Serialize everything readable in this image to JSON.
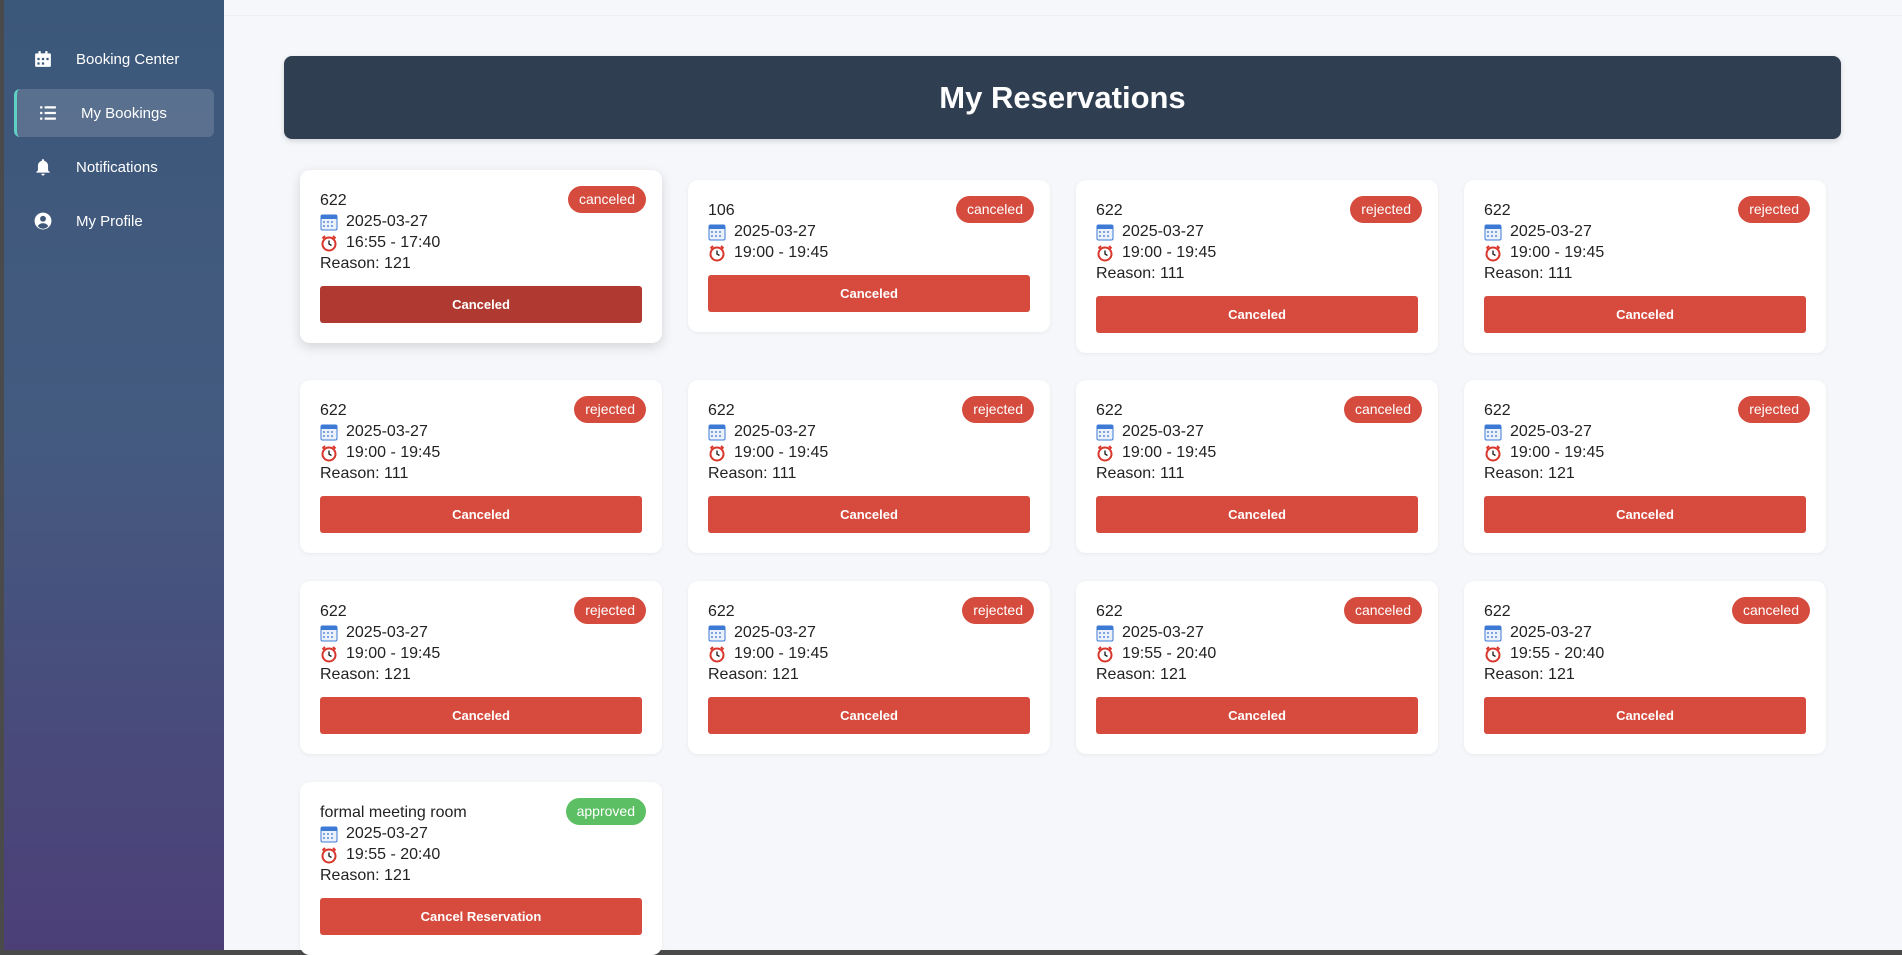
{
  "sidebar": {
    "items": [
      {
        "label": "Booking Center",
        "icon": "calendar-icon",
        "active": false
      },
      {
        "label": "My Bookings",
        "icon": "list-icon",
        "active": true
      },
      {
        "label": "Notifications",
        "icon": "bell-icon",
        "active": false
      },
      {
        "label": "My Profile",
        "icon": "user-circle-icon",
        "active": false
      }
    ]
  },
  "header": {
    "title": "My Reservations"
  },
  "colors": {
    "header_bg": "#2f3e51",
    "danger": "#d74b3e",
    "approved": "#5cbf63",
    "sidebar_top": "#3b5779",
    "sidebar_bottom": "#4c3f78"
  },
  "reservations": [
    {
      "room": "622",
      "date": "2025-03-27",
      "time": "16:55 - 17:40",
      "reason": "Reason: 121",
      "status": "canceled",
      "button": "Canceled"
    },
    {
      "room": "106",
      "date": "2025-03-27",
      "time": "19:00 - 19:45",
      "reason": "",
      "status": "canceled",
      "button": "Canceled"
    },
    {
      "room": "622",
      "date": "2025-03-27",
      "time": "19:00 - 19:45",
      "reason": "Reason: 111",
      "status": "rejected",
      "button": "Canceled"
    },
    {
      "room": "622",
      "date": "2025-03-27",
      "time": "19:00 - 19:45",
      "reason": "Reason: 111",
      "status": "rejected",
      "button": "Canceled"
    },
    {
      "room": "622",
      "date": "2025-03-27",
      "time": "19:00 - 19:45",
      "reason": "Reason: 111",
      "status": "rejected",
      "button": "Canceled"
    },
    {
      "room": "622",
      "date": "2025-03-27",
      "time": "19:00 - 19:45",
      "reason": "Reason: 111",
      "status": "rejected",
      "button": "Canceled"
    },
    {
      "room": "622",
      "date": "2025-03-27",
      "time": "19:00 - 19:45",
      "reason": "Reason: 111",
      "status": "canceled",
      "button": "Canceled"
    },
    {
      "room": "622",
      "date": "2025-03-27",
      "time": "19:00 - 19:45",
      "reason": "Reason: 121",
      "status": "rejected",
      "button": "Canceled"
    },
    {
      "room": "622",
      "date": "2025-03-27",
      "time": "19:00 - 19:45",
      "reason": "Reason: 121",
      "status": "rejected",
      "button": "Canceled"
    },
    {
      "room": "622",
      "date": "2025-03-27",
      "time": "19:00 - 19:45",
      "reason": "Reason: 121",
      "status": "rejected",
      "button": "Canceled"
    },
    {
      "room": "622",
      "date": "2025-03-27",
      "time": "19:55 - 20:40",
      "reason": "Reason: 121",
      "status": "canceled",
      "button": "Canceled"
    },
    {
      "room": "622",
      "date": "2025-03-27",
      "time": "19:55 - 20:40",
      "reason": "Reason: 121",
      "status": "canceled",
      "button": "Canceled"
    },
    {
      "room": "formal meeting room",
      "date": "2025-03-27",
      "time": "19:55 - 20:40",
      "reason": "Reason: 121",
      "status": "approved",
      "button": "Cancel Reservation"
    }
  ]
}
